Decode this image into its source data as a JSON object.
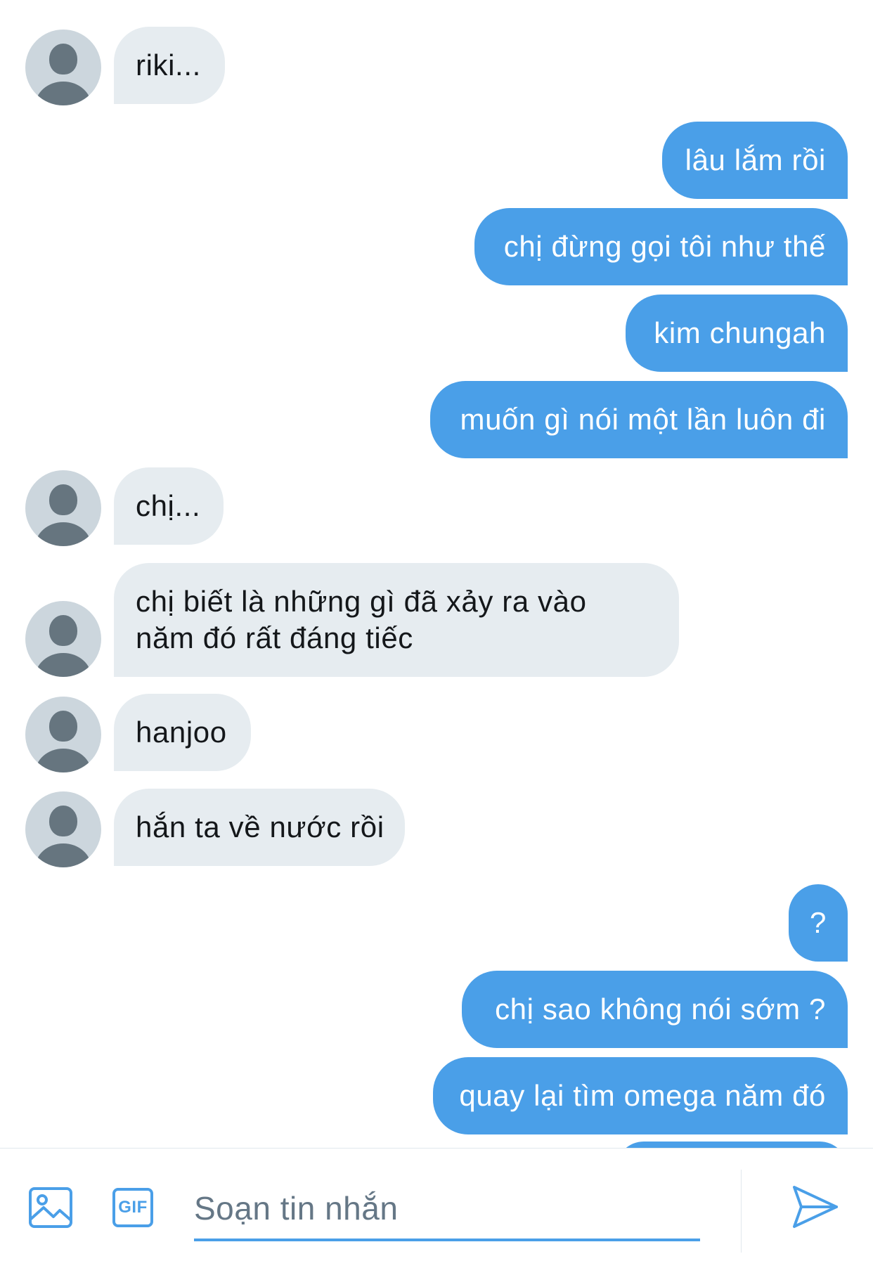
{
  "messages": [
    {
      "side": "in",
      "text": "riki...",
      "avatar": "default-avatar"
    },
    {
      "side": "out",
      "text": "lâu lắm rồi"
    },
    {
      "side": "out",
      "text": "chị đừng gọi tôi như thế"
    },
    {
      "side": "out",
      "text": "kim chungah"
    },
    {
      "side": "out",
      "text": "muốn gì nói một lần luôn đi"
    },
    {
      "side": "in",
      "text": "chị...",
      "avatar": "default-avatar"
    },
    {
      "side": "in",
      "text": "chị biết là những gì đã xảy ra vào năm đó rất đáng tiếc",
      "avatar": "default-avatar"
    },
    {
      "side": "in",
      "text": "hanjoo",
      "avatar": "default-avatar"
    },
    {
      "side": "in",
      "text": "hắn ta về nước rồi",
      "avatar": "default-avatar"
    },
    {
      "side": "out",
      "text": "?"
    },
    {
      "side": "out",
      "text": "chị sao không nói sớm ?"
    },
    {
      "side": "out",
      "text": "quay lại tìm omega năm đó"
    }
  ],
  "composer": {
    "placeholder": "Soạn tin nhắn",
    "gif_label": "GIF",
    "media_icon": "image-icon",
    "send_icon": "send-icon"
  },
  "colors": {
    "outgoing_bubble": "#4a9fe8",
    "incoming_bubble": "#e6ecf0",
    "accent": "#4a9fe8",
    "avatar_bg": "#ccd6dd",
    "avatar_fg": "#66757f"
  }
}
